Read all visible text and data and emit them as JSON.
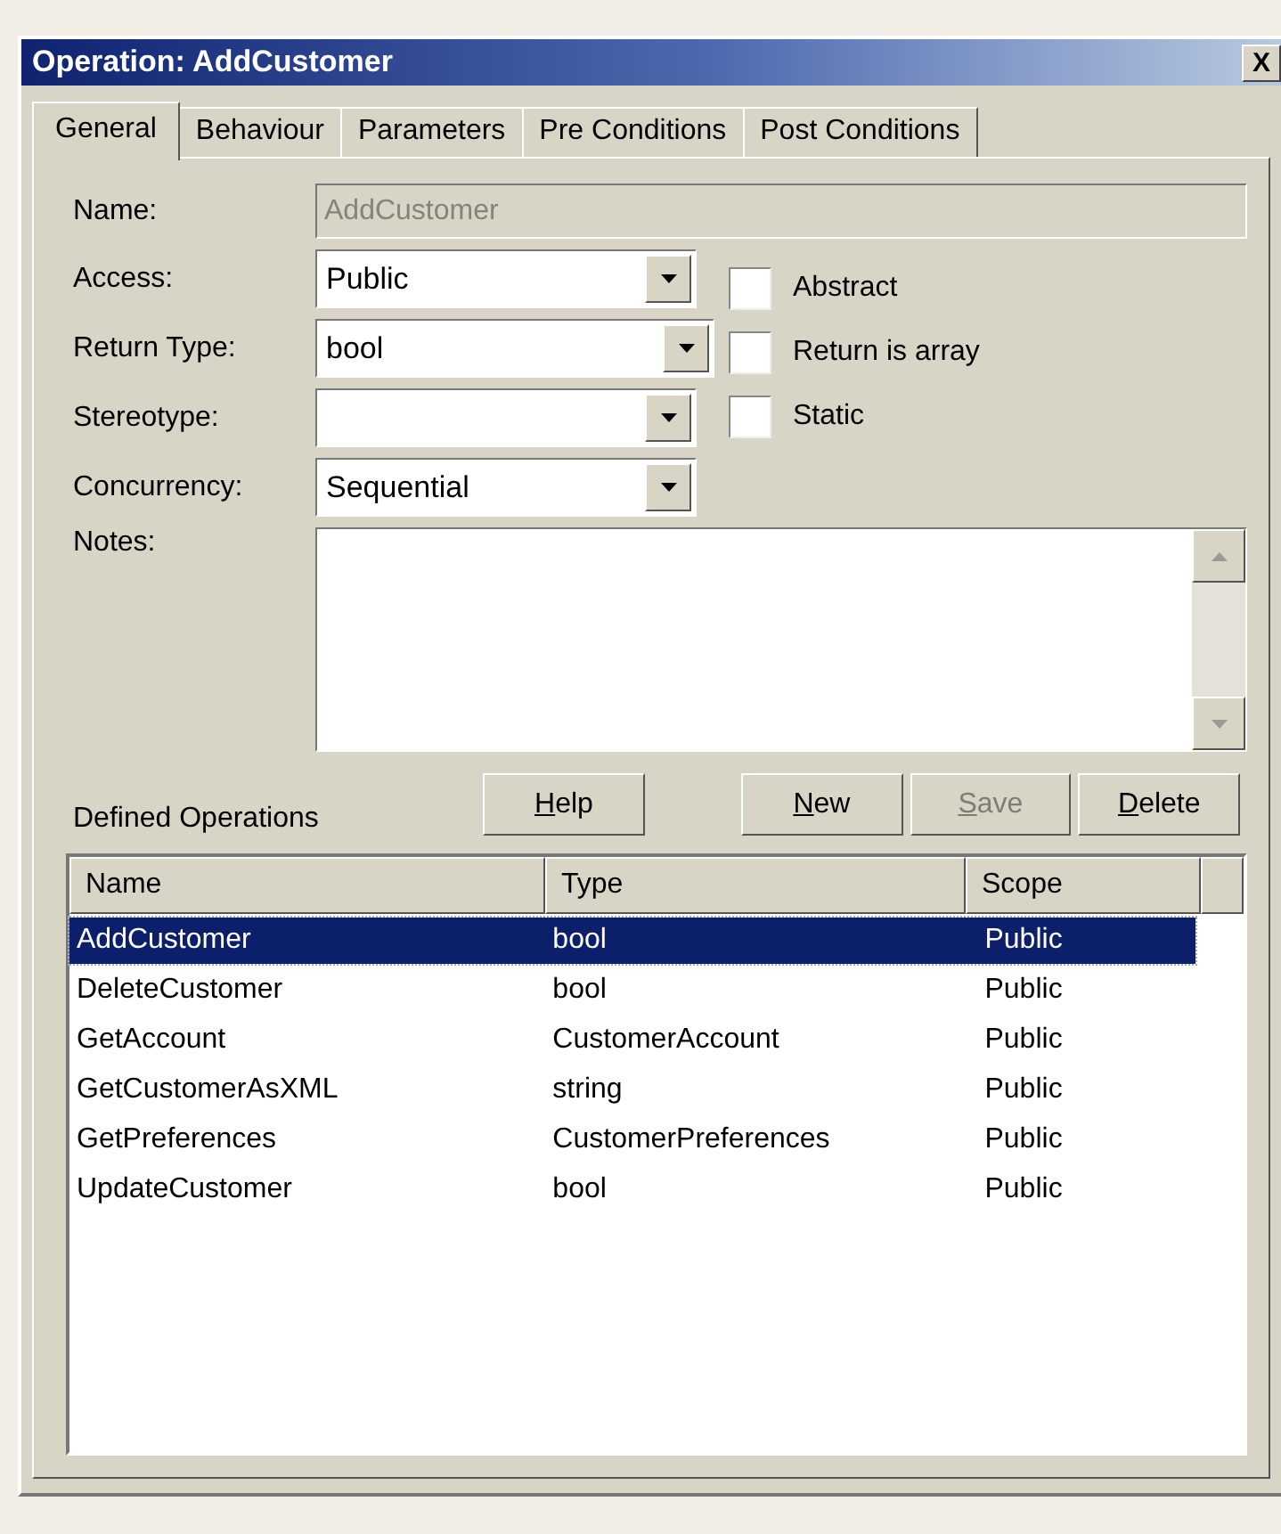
{
  "window": {
    "title": "Operation: AddCustomer",
    "close": "X"
  },
  "tabs": [
    {
      "label": "General",
      "selected": true
    },
    {
      "label": "Behaviour",
      "selected": false
    },
    {
      "label": "Parameters",
      "selected": false
    },
    {
      "label": "Pre Conditions",
      "selected": false
    },
    {
      "label": "Post Conditions",
      "selected": false
    }
  ],
  "name_field": {
    "label": "Name:",
    "value": "AddCustomer",
    "disabled": true
  },
  "fields": [
    {
      "label": "Access:",
      "value": "Public"
    },
    {
      "label": "Return Type:",
      "value": "bool"
    },
    {
      "label": "Stereotype:"
    },
    {
      "label": "Concurrency:",
      "value": "Sequential"
    }
  ],
  "checkboxes": [
    {
      "label": "Abstract",
      "checked": false
    },
    {
      "label": "Return is array",
      "checked": false
    },
    {
      "label": "Static",
      "checked": false
    }
  ],
  "notes": {
    "label": "Notes:"
  },
  "defined_operations_label": "Defined Operations",
  "buttons": [
    {
      "label": "Help",
      "disabled": false,
      "mnemonic": true
    },
    {
      "label": "New",
      "disabled": false,
      "mnemonic": true
    },
    {
      "label": "Save",
      "disabled": true,
      "mnemonic": true
    },
    {
      "label": "Delete",
      "disabled": false,
      "mnemonic": true
    }
  ],
  "table": {
    "columns": [
      "Name",
      "Type",
      "Scope"
    ],
    "rows": [
      {
        "cells": [
          "AddCustomer",
          "bool",
          "Public"
        ],
        "selected": true
      },
      {
        "cells": [
          "DeleteCustomer",
          "bool",
          "Public"
        ],
        "selected": false
      },
      {
        "cells": [
          "GetAccount",
          "CustomerAccount",
          "Public"
        ],
        "selected": false
      },
      {
        "cells": [
          "GetCustomerAsXML",
          "string",
          "Public"
        ],
        "selected": false
      },
      {
        "cells": [
          "GetPreferences",
          "CustomerPreferences",
          "Public"
        ],
        "selected": false
      },
      {
        "cells": [
          "UpdateCustomer",
          "bool",
          "Public"
        ],
        "selected": false
      }
    ]
  }
}
